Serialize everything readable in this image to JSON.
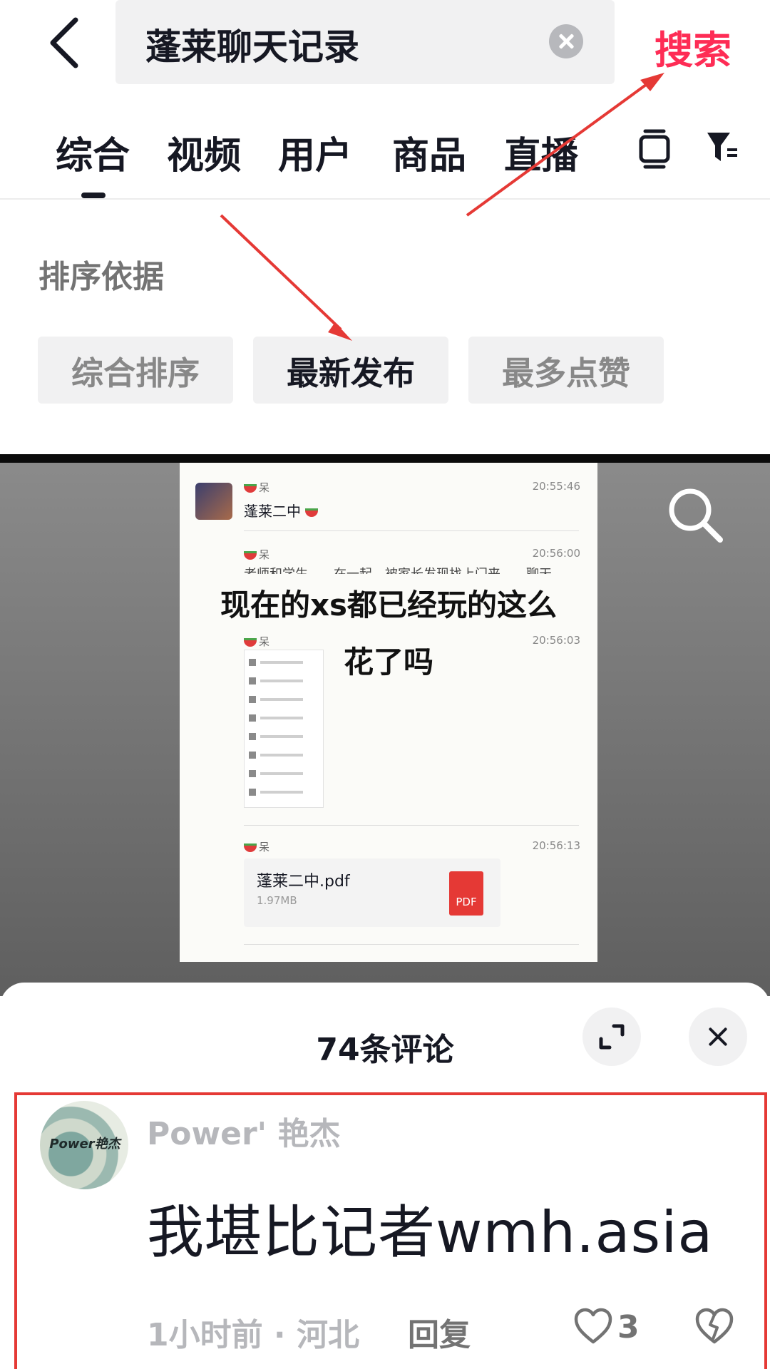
{
  "search": {
    "query": "蓬莱聊天记录",
    "submit_label": "搜索"
  },
  "tabs": [
    "综合",
    "视频",
    "用户",
    "商品",
    "直播"
  ],
  "active_tab": "综合",
  "sort": {
    "title": "排序依据",
    "options": [
      "综合排序",
      "最新发布",
      "最多点赞"
    ],
    "selected": "最新发布"
  },
  "video": {
    "caption_line1": "现在的xs都已经玩的这么",
    "caption_line2": "花了吗",
    "messages": [
      {
        "sender": "呆",
        "time": "20:55:46",
        "text": "蓬莱二中"
      },
      {
        "sender": "呆",
        "time": "20:56:00",
        "text": "老师和学生……在一起，被家长发现找上门来……聊天"
      },
      {
        "sender": "呆",
        "time": "20:56:03",
        "text": ""
      },
      {
        "sender": "呆",
        "time": "20:56:13",
        "text": ""
      }
    ],
    "file": {
      "name": "蓬莱二中.pdf",
      "size": "1.97MB",
      "type_label": "PDF"
    }
  },
  "comments": {
    "title": "74条评论",
    "item": {
      "avatar_text": "Power艳杰",
      "username": "Power' 艳杰",
      "text": "我堪比记者wmh.asia",
      "meta": "1小时前 · 河北",
      "reply_label": "回复",
      "like_count": "3"
    }
  },
  "colors": {
    "accent": "#fe2c55",
    "annotation": "#e53935"
  }
}
